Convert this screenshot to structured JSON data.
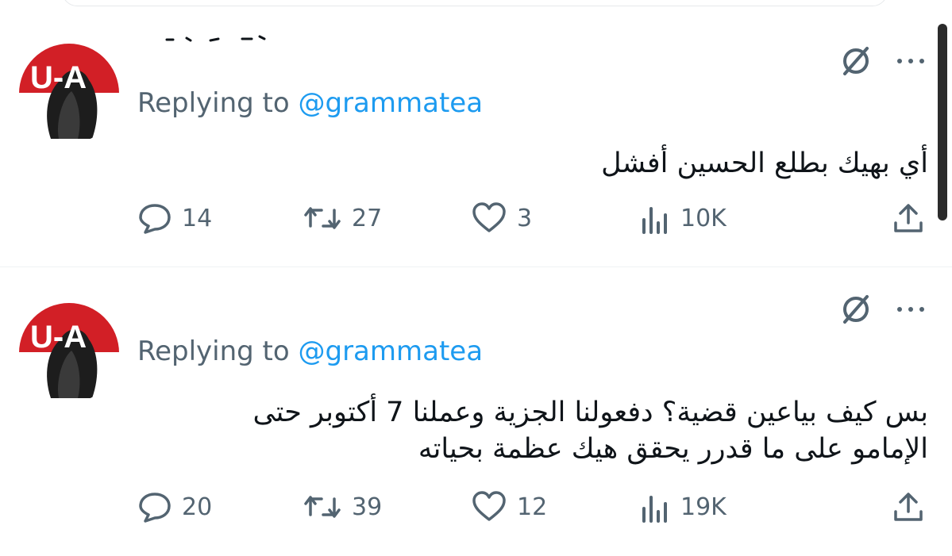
{
  "tweets": [
    {
      "replying_label": "Replying to",
      "handle": "@grammatea",
      "text_lines": [
        "أي بهيك بطلع الحسين أفشل"
      ],
      "replies": "14",
      "reposts": "27",
      "likes": "3",
      "views": "10K"
    },
    {
      "replying_label": "Replying to",
      "handle": "@grammatea",
      "text_lines": [
        "بس كيف بياعين قضية؟ دفعولنا الجزية وعملنا 7 أكتوبر حتى",
        "الإمامو على ما قدرر يحقق هيك عظمة بحياته"
      ],
      "replies": "20",
      "reposts": "39",
      "likes": "12",
      "views": "19K"
    }
  ],
  "avatar_text": "U‑A",
  "colors": {
    "accent": "#1d9bf0",
    "muted": "#536471",
    "text": "#0f1419",
    "divider": "#eff3f4"
  }
}
